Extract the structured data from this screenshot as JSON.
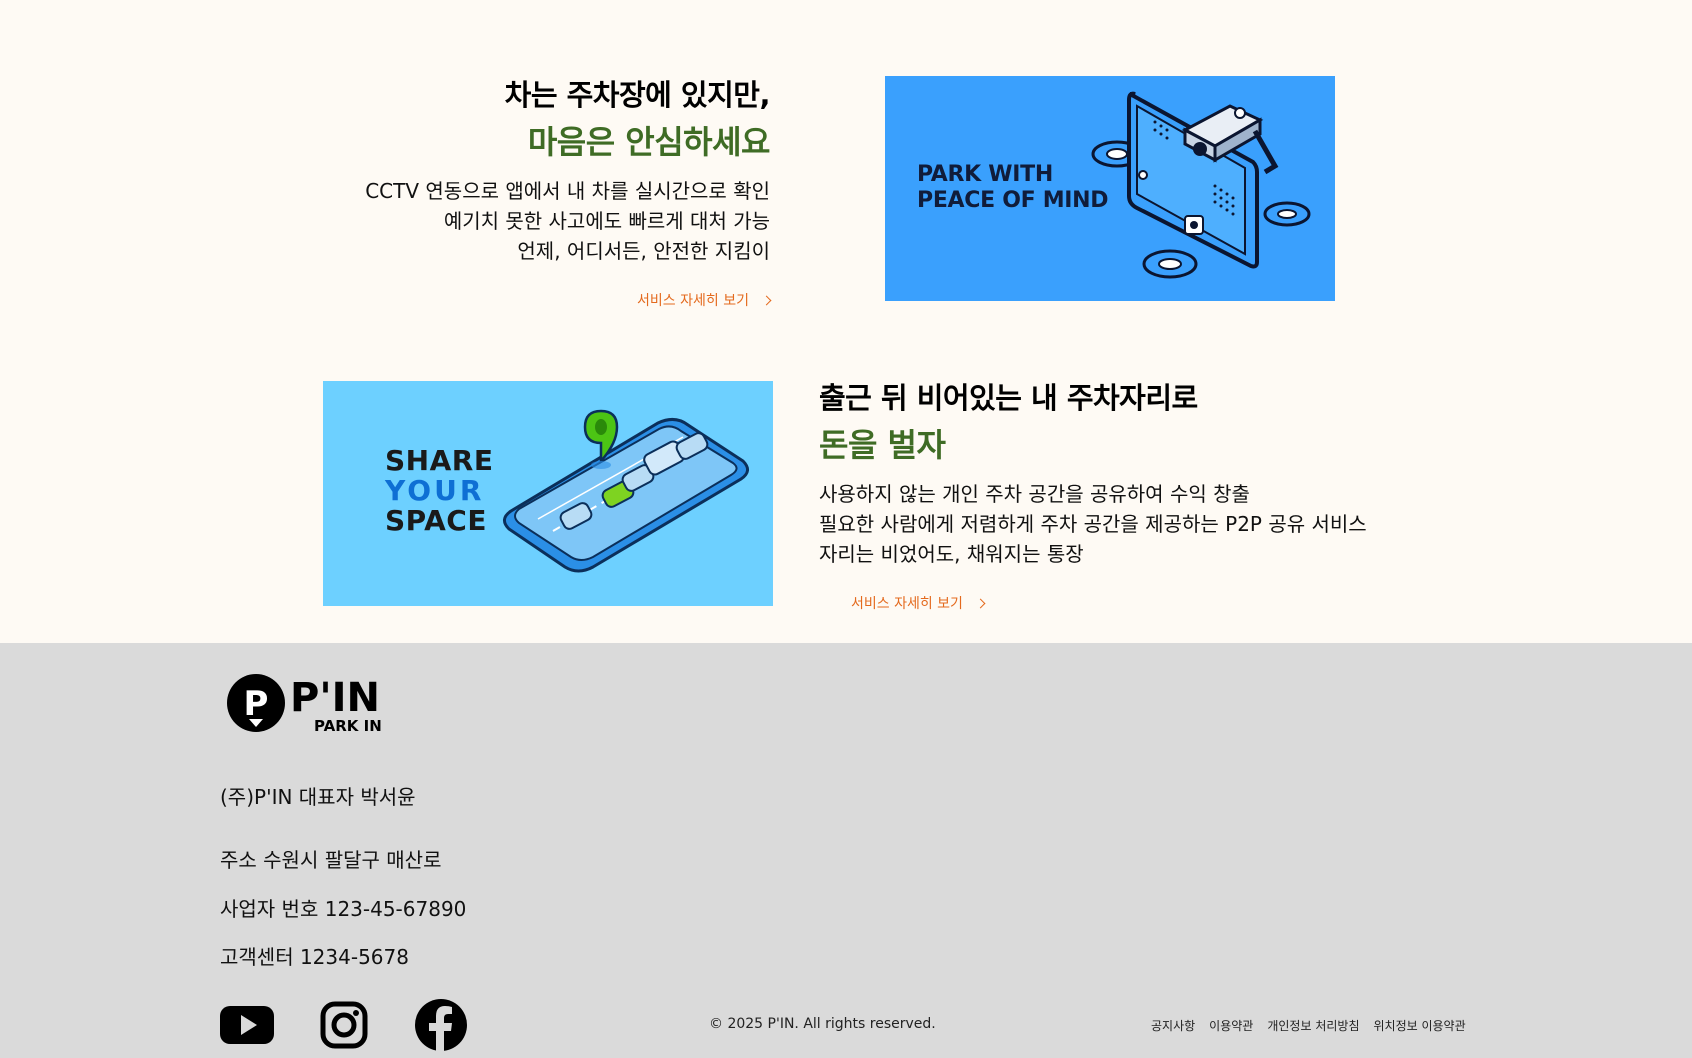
{
  "feature1": {
    "title_line1": "차는 주차장에 있지만,",
    "title_line2": "마음은 안심하세요",
    "desc_lines": [
      "CCTV 연동으로 앱에서 내 차를 실시간으로 확인",
      "예기치 못한 사고에도 빠르게 대처 가능",
      "언제, 어디서든, 안전한 지킴이"
    ],
    "more_label": "서비스 자세히 보기",
    "banner_text_line1": "PARK WITH",
    "banner_text_line2": "PEACE OF MIND",
    "banner_bg": "#3aa0fd"
  },
  "feature2": {
    "title_line1": "출근 뒤 비어있는 내 주차자리로",
    "title_line2": "돈을 벌자",
    "desc_lines": [
      "사용하지 않는 개인 주차 공간을 공유하여 수익 창출",
      "필요한 사람에게 저렴하게 주차 공간을 제공하는 P2P 공유 서비스",
      "자리는 비었어도, 채워지는 통장"
    ],
    "more_label": "서비스 자세히 보기",
    "banner_text_line1": "SHARE",
    "banner_text_line2": "YOUR",
    "banner_text_line3": "SPACE",
    "banner_bg": "#6dd0ff"
  },
  "footer": {
    "logo_text_main": "P'IN",
    "logo_text_sub": "PARK IN",
    "company": "(주)P'IN 대표자 박서윤",
    "address": "주소 수원시 팔달구 매산로",
    "business_no": "사업자 번호 123-45-67890",
    "customer_center": "고객센터 1234-5678",
    "copyright": "© 2025 P'IN. All rights reserved.",
    "links": [
      "공지사항",
      "이용약관",
      "개인정보 처리방침",
      "위치정보 이용약관"
    ],
    "social": [
      "youtube-icon",
      "instagram-icon",
      "facebook-icon"
    ]
  },
  "colors": {
    "accent_green": "#3f6c25",
    "link_orange": "#e46a1e",
    "page_bg": "#fefaf4",
    "footer_bg": "#dadada"
  }
}
